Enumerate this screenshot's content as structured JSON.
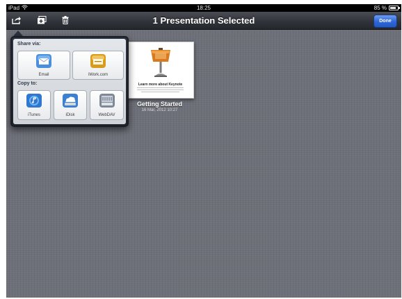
{
  "status_bar": {
    "carrier": "iPad",
    "time": "18:25",
    "battery": "85 %"
  },
  "toolbar": {
    "title": "1 Presentation Selected",
    "done_label": "Done",
    "icons": [
      "share-icon",
      "add-document-icon",
      "trash-icon"
    ]
  },
  "popover": {
    "share_label": "Share via:",
    "share_items": [
      {
        "label": "Email",
        "icon": "email-icon"
      },
      {
        "label": "iWork.com",
        "icon": "iwork-icon"
      }
    ],
    "copy_label": "Copy to:",
    "copy_items": [
      {
        "label": "iTunes",
        "icon": "itunes-icon"
      },
      {
        "label": "iDisk",
        "icon": "idisk-icon"
      },
      {
        "label": "WebDAV",
        "icon": "webdav-icon"
      }
    ]
  },
  "document": {
    "thumbnail_caption": "Learn more about Keynote",
    "title": "Getting Started",
    "date": "16 Mar, 2012 10:27"
  },
  "colors": {
    "accent": "#2d66d8",
    "background": "#6d7078",
    "toolbar": "#2f3238"
  }
}
